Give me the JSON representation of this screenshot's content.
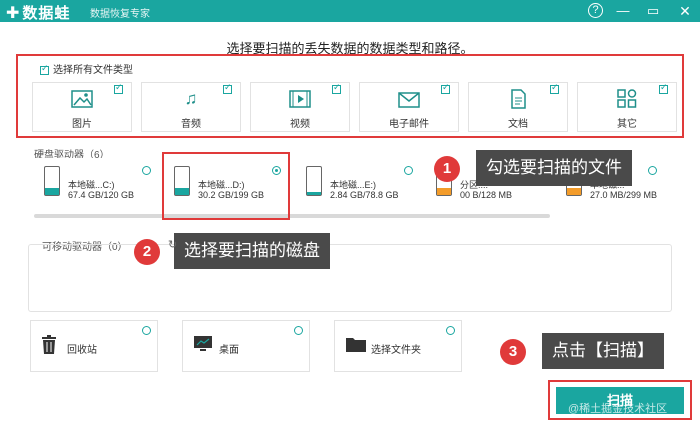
{
  "app": {
    "name": "数据蛙",
    "subtitle": "数据恢复专家",
    "help": "?"
  },
  "heading": "选择要扫描的丢失数据的数据类型和路径。",
  "file_types": {
    "select_all_label": "选择所有文件类型",
    "items": [
      {
        "label": "图片",
        "icon": "image-icon",
        "checked": true
      },
      {
        "label": "音频",
        "icon": "music-icon",
        "checked": true
      },
      {
        "label": "视频",
        "icon": "video-icon",
        "checked": true
      },
      {
        "label": "电子邮件",
        "icon": "mail-icon",
        "checked": true
      },
      {
        "label": "文档",
        "icon": "document-icon",
        "checked": true
      },
      {
        "label": "其它",
        "icon": "other-icon",
        "checked": true
      }
    ]
  },
  "hard_drives": {
    "label": "硬盘驱动器（6）",
    "items": [
      {
        "name": "本地磁...C:)",
        "size": "67.4 GB/120 GB",
        "selected": false
      },
      {
        "name": "本地磁...D:)",
        "size": "30.2 GB/199 GB",
        "selected": true
      },
      {
        "name": "本地磁...E:)",
        "size": "2.84 GB/78.8 GB",
        "selected": false
      },
      {
        "name": "分区:...",
        "size": "00 B/128 MB",
        "selected": false
      },
      {
        "name": "本地磁...",
        "size": "27.0 MB/299 MB",
        "selected": false
      }
    ]
  },
  "removable": {
    "label": "可移动驱动器（0）"
  },
  "locations": [
    {
      "label": "回收站",
      "icon": "recycle-bin-icon"
    },
    {
      "label": "桌面",
      "icon": "desktop-icon"
    },
    {
      "label": "选择文件夹",
      "icon": "folder-icon"
    }
  ],
  "scan_label": "扫描",
  "callouts": [
    {
      "num": "1",
      "text": "勾选要扫描的文件"
    },
    {
      "num": "2",
      "text": "选择要扫描的磁盘"
    },
    {
      "num": "3",
      "text": "点击【扫描】"
    }
  ],
  "watermark": "@稀土掘金技术社区",
  "colors": {
    "accent": "#1aa6a0",
    "highlight": "#e03a3a",
    "tip_bg": "#4a4a4a"
  }
}
